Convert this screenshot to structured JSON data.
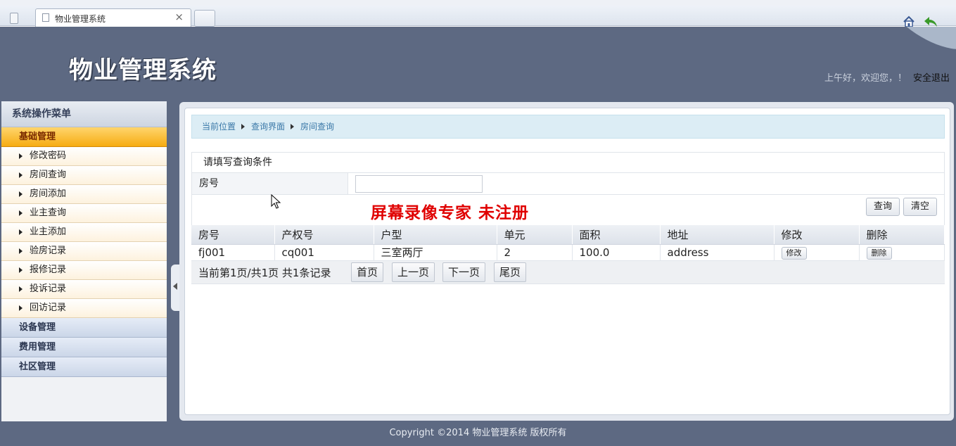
{
  "browser": {
    "tab_title": "物业管理系统",
    "tab_close": "×"
  },
  "header": {
    "logo": "物业管理系统",
    "greeting": "上午好，欢迎您，！",
    "logout": "安全退出"
  },
  "sidebar": {
    "title": "系统操作菜单",
    "active_group": "基础管理",
    "items": [
      {
        "label": "修改密码"
      },
      {
        "label": "房间查询"
      },
      {
        "label": "房间添加"
      },
      {
        "label": "业主查询"
      },
      {
        "label": "业主添加"
      },
      {
        "label": "验房记录"
      },
      {
        "label": "报修记录"
      },
      {
        "label": "投诉记录"
      },
      {
        "label": "回访记录"
      }
    ],
    "groups": [
      {
        "label": "设备管理"
      },
      {
        "label": "费用管理"
      },
      {
        "label": "社区管理"
      }
    ]
  },
  "breadcrumb": {
    "items": [
      "当前位置",
      "查询界面",
      "房间查询"
    ]
  },
  "query": {
    "heading": "请填写查询条件",
    "field_label": "房号",
    "field_value": "",
    "query_button": "查询",
    "clear_button": "清空"
  },
  "watermark": "屏幕录像专家  未注册",
  "results": {
    "columns": [
      "房号",
      "产权号",
      "户型",
      "单元",
      "面积",
      "地址",
      "修改",
      "删除"
    ],
    "rows": [
      {
        "room": "fj001",
        "property": "cq001",
        "layout": "三室两厅",
        "unit": "2",
        "area": "100.0",
        "address": "address",
        "edit": "修改",
        "delete": "删除"
      }
    ]
  },
  "pager": {
    "info": "当前第1页/共1页  共1条记录",
    "first": "首页",
    "prev": "上一页",
    "next": "下一页",
    "last": "尾页"
  },
  "footer": "Copyright ©2014 物业管理系统 版权所有",
  "colors": {
    "header_bg": "#5d6982",
    "menu_active": "#f6ac12",
    "breadcrumb_bg": "#dcedf5",
    "watermark": "#e00000"
  }
}
